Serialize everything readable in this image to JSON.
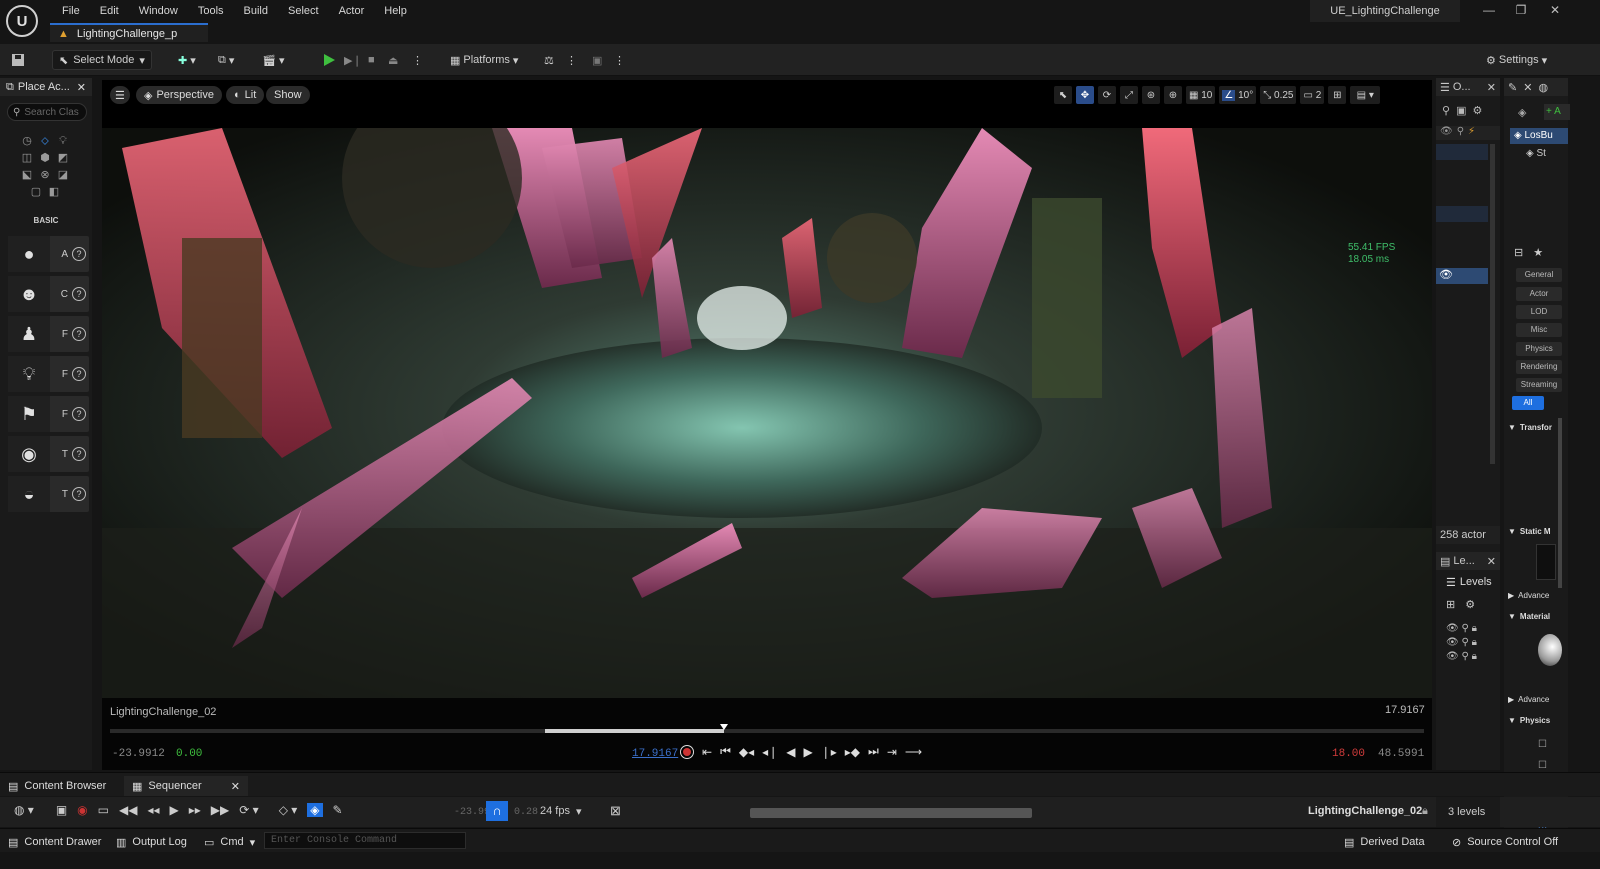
{
  "window": {
    "logo": "U",
    "menu": [
      "File",
      "Edit",
      "Window",
      "Tools",
      "Build",
      "Select",
      "Actor",
      "Help"
    ],
    "level_tab": "LightingChallenge_p",
    "project_name": "UE_LightingChallenge",
    "controls": [
      "—",
      "❐",
      "✕"
    ]
  },
  "toolbar": {
    "select_mode": "Select Mode",
    "platforms": "Platforms",
    "settings": "Settings"
  },
  "place_actors": {
    "title": "Place Ac...",
    "search_placeholder": "Search Clas",
    "category": "BASIC",
    "items": [
      {
        "icon": "sphere",
        "label": "A"
      },
      {
        "icon": "character",
        "label": "C"
      },
      {
        "icon": "pawn",
        "label": "F"
      },
      {
        "icon": "point-light",
        "label": "F"
      },
      {
        "icon": "player-start",
        "label": "F"
      },
      {
        "icon": "trigger-box",
        "label": "T"
      },
      {
        "icon": "trigger-sphere",
        "label": "T"
      }
    ]
  },
  "viewport": {
    "perspective": "Perspective",
    "lit": "Lit",
    "show": "Show",
    "grid_snap": "10",
    "rotate_snap": "10°",
    "scale_snap": "0.25",
    "camera_speed": "2",
    "fps": "55.41 FPS",
    "ms": "18.05 ms"
  },
  "sequencer_view": {
    "sequence_name": "LightingChallenge_02",
    "current_time": "17.9167",
    "range_start": "-23.9912",
    "play_start": "0.00",
    "playhead": "17.9167",
    "play_end": "18.00",
    "range_end": "48.5991",
    "playhead_position": 0.467
  },
  "bottom_tabs": {
    "content_browser": "Content Browser",
    "sequencer": "Sequencer"
  },
  "seq_toolbar": {
    "fps": "24 fps",
    "t1": "-23.9912",
    "t2": "0.28",
    "sequence": "LightingChallenge_02"
  },
  "outliner": {
    "title": "O...",
    "actor_count": "258 actor",
    "levels_title": "Le...",
    "levels_label": "Levels",
    "levels_count": "3 levels"
  },
  "details": {
    "selected": "LosBu",
    "component": "St",
    "filters": [
      "General",
      "Actor",
      "LOD",
      "Misc",
      "Physics",
      "Rendering",
      "Streaming",
      "All"
    ],
    "sections": [
      "Transfor",
      "Static M",
      "Advance",
      "Material",
      "Advance",
      "Physics"
    ],
    "add_label": "+ A"
  },
  "statusbar": {
    "content_drawer": "Content Drawer",
    "output_log": "Output Log",
    "cmd": "Cmd",
    "console_placeholder": "Enter Console Command",
    "derived_data": "Derived Data",
    "source_control": "Source Control Off"
  },
  "colors": {
    "accent": "#2b6ecf",
    "play_green": "#3fbf3f",
    "fps_green": "#3fbf6a",
    "range_red": "#d23c3c",
    "timeline_blue": "#3b6fc9"
  }
}
